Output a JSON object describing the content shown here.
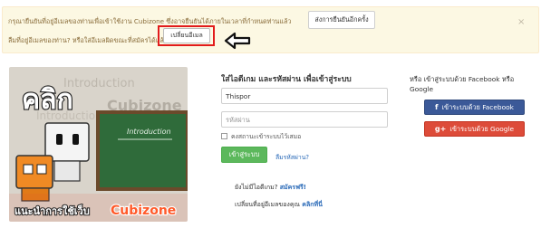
{
  "alert": {
    "line1": "กรุณายืนยันที่อยู่อีเมลของท่านเพื่อเข้าใช้งาน Cubizone ซึ่งอาจยืนยันได้ภายในเวลาที่กำหนดท่านแล้ว",
    "resend_label": "ส่งการยืนยันอีกครั้ง",
    "line2": "ลืมที่อยู่อีเมลของท่าน? หรือใส่อีเมลผิดขณะที่สมัครได้แล้ว",
    "change_email_label": "เปลี่ยนอีเมล",
    "close_glyph": "×"
  },
  "promo": {
    "big_word": "คลิก",
    "small_text": "แนะนำการใช้เว็บ",
    "brand": "Cubizone",
    "board_word": "Introduction",
    "bg_text_1": "Introduction",
    "bg_text_2": "Cubizone",
    "bg_text_3": "Introduction"
  },
  "login": {
    "title": "ใส่ไอดีเกม และรหัสผ่าน เพื่อเข้าสู่ระบบ",
    "username_value": "Thispor",
    "password_placeholder": "รหัสผ่าน",
    "remember_label": "คงสถานะเข้าระบบไว้เสมอ",
    "login_button": "เข้าสู่ระบบ",
    "forgot_link": "ลืมรหัสผ่าน?",
    "no_id_text": "ยังไม่มีไอดีเกม?",
    "register_link": "สมัครฟรี!",
    "change_email_text": "เปลี่ยนที่อยู่อีเมลของคุณ",
    "click_here_link": "คลิกที่นี่"
  },
  "social": {
    "title": "หรือ เข้าสู่ระบบด้วย Facebook หรือ Google",
    "facebook_label": "เข้าระบบด้วย Facebook",
    "google_label": "เข้าระบบด้วย Google",
    "facebook_glyph": "f",
    "google_glyph": "g+"
  },
  "colors": {
    "alert_bg": "#fcf8e3",
    "highlight": "#e21b1b",
    "login_green": "#5cb85c",
    "facebook_blue": "#3b5998",
    "google_red": "#dd4b39",
    "link_blue": "#2a6ab8"
  }
}
